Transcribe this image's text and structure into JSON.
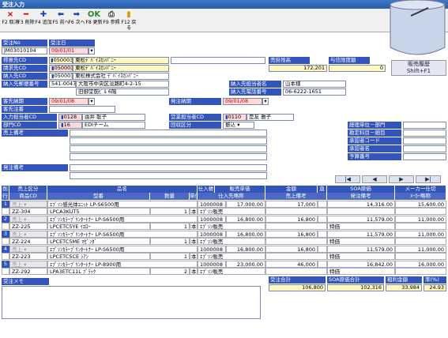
{
  "window": {
    "title": "受注入力"
  },
  "toolbar": [
    {
      "key": "F2",
      "label": "取消",
      "icon": "x-icon",
      "glyph": "×",
      "color": "#c00000"
    },
    {
      "key": "F3",
      "label": "削除",
      "icon": "minus-icon",
      "glyph": "━",
      "color": "#c00000"
    },
    {
      "key": "F4",
      "label": "追加",
      "icon": "plus-icon",
      "glyph": "✚",
      "color": "#2244aa"
    },
    {
      "key": "F5",
      "label": "前へ",
      "icon": "arrow-left-icon",
      "glyph": "⬅",
      "color": "#2244aa"
    },
    {
      "key": "F6",
      "label": "次へ",
      "icon": "arrow-right-icon",
      "glyph": "➡",
      "color": "#2244aa"
    },
    {
      "key": "F8",
      "label": "更新",
      "icon": "ok-icon",
      "glyph": "OK",
      "color": "#228833"
    },
    {
      "key": "F9",
      "label": "参照",
      "icon": "reference-icon",
      "glyph": "⎙",
      "color": "#444444"
    },
    {
      "key": "F12",
      "label": "戻る",
      "icon": "return-icon",
      "glyph": "▮",
      "color": "#d0a000"
    }
  ],
  "side_buttons": {
    "history": "販売履歴",
    "history_key": "Shift+F1"
  },
  "header": {
    "order_no_label": "受注No",
    "order_no": "JM03010104",
    "order_date_label": "受注日",
    "order_date": "09/01/01",
    "sales_price_label": "売掛残高",
    "sales_price": "172,201",
    "credit_label": "与信限度額",
    "credit": "0",
    "customer_label": "得意先CD",
    "customer_code": "0500039",
    "customer_name": "東松ﾃﾞﾊﾞｲｽｶﾝﾊﾟﾆｰ",
    "bill_label": "請求先CD",
    "bill_code": "0500039",
    "bill_name": "東松ﾃﾞﾊﾞｲｽｶﾝﾊﾟﾆｰ",
    "ship_label": "納入先CD",
    "ship_code": "0500039",
    "ship_name": "東松株式会社 ﾃﾞﾊﾞｲｽｶﾝﾊﾟﾆｰ",
    "zip_label": "納入先郵便番号",
    "zip": "541-0047",
    "address1": "大阪市中央区淡路町4-2-15",
    "address2": "旧御堂筋ﾋﾞﾙ 6階",
    "contact_label": "納入先担当者名",
    "contact": "山本様",
    "phone_label": "納入先電話番号",
    "phone": "06-6222-1651",
    "cust_due_label": "客先納期",
    "cust_due": "09/01/08",
    "ship_due_label": "発注納期",
    "ship_due": "09/01/08",
    "cust_order_label": "客先注番",
    "input_staff_label": "入力担当者CD",
    "input_staff_code": "0128",
    "input_staff_name": "由井 聡子",
    "sales_staff_label": "営業担当者CD",
    "sales_staff_code": "0110",
    "sales_staff_name": "是友 雅子",
    "dept_label": "部門CD",
    "dept_code": "16",
    "dept_name": "EDIチーム",
    "collect_label": "回収区分",
    "collect": "振込",
    "remarks_label": "売上備考",
    "order_remarks_label": "発注備考",
    "right_labels": [
      "経理単位－部門",
      "勘定科目－細目",
      "承認者コード",
      "承認者名",
      "予算番号"
    ]
  },
  "grid": {
    "headers": [
      "削",
      "売上区分",
      "品名",
      "仕入帳",
      "販売単価",
      "金額",
      "直",
      "SOA原価",
      "メーカー仕切"
    ],
    "subheaders": [
      "行",
      "商品CD",
      "型番",
      "数量",
      "単位",
      "仕入先略称",
      "売上備考",
      "発注備考",
      "ﾒｰｶｰ略称"
    ],
    "rows": [
      {
        "n": "1",
        "kbn": "売上",
        "name": "ｴﾌﾟｿﾝ感光体ﾕﾆｯﾄ LP-S6500用",
        "code": "ZZ-304",
        "model": "LPCA3KUT5",
        "qty": "1",
        "unit": "本",
        "sup": "1000008",
        "supname": "ｴﾌﾟｿﾝ販売",
        "price": "17,000.00",
        "amount": "17,000",
        "soa": "14,316.00",
        "maker": "15,600.00",
        "note": ""
      },
      {
        "n": "2",
        "kbn": "売上",
        "name": "ｴﾌﾟｿﾝｶﾗｰﾌﾟﾘﾝﾀｰﾄﾅｰ LP-S6500用",
        "code": "ZZ-225",
        "model": "LPCETC5YE",
        "qty": "1",
        "unit": "本",
        "sup": "1000008",
        "supname": "ｴﾌﾟｿﾝ販売",
        "price": "16,800.00",
        "amount": "16,800",
        "soa": "11,579.00",
        "maker": "11,000.00",
        "note": "特価",
        "colorname": "ｲｴﾛｰ"
      },
      {
        "n": "3",
        "kbn": "売上",
        "name": "ｴﾌﾟｿﾝｶﾗｰﾌﾟﾘﾝﾀｰﾄﾅｰ LP-S6500用",
        "code": "ZZ-224",
        "model": "LPCETC5ME",
        "qty": "1",
        "unit": "本",
        "sup": "1000008",
        "supname": "ｴﾌﾟｿﾝ販売",
        "price": "16,800.00",
        "amount": "16,800",
        "soa": "11,579.00",
        "maker": "11,000.00",
        "note": "特価",
        "colorname": "ﾏｾﾞﾝﾀﾞ"
      },
      {
        "n": "4",
        "kbn": "売上",
        "name": "ｴﾌﾟｿﾝｶﾗｰﾌﾟﾘﾝﾀｰﾄﾅｰ LP-S6500用",
        "code": "ZZ-223",
        "model": "LPCETC5CE",
        "qty": "1",
        "unit": "本",
        "sup": "1000008",
        "supname": "ｴﾌﾟｿﾝ販売",
        "price": "16,800.00",
        "amount": "16,800",
        "soa": "11,579.00",
        "maker": "11,000.00",
        "note": "特価",
        "colorname": "ｼｱﾝ"
      },
      {
        "n": "5",
        "kbn": "売上",
        "name": "ｴﾌﾟｿﾝｶﾗｰﾌﾟﾘﾝﾀｰﾄﾅｰ LP-8900用",
        "code": "ZZ-292",
        "model": "LPA3ETC11L",
        "qty": "2",
        "unit": "本",
        "sup": "1000008",
        "supname": "ｴﾌﾟｿﾝ販売",
        "price": "23,000.00",
        "amount": "46,000",
        "soa": "16,842.00",
        "maker": "16,000.00",
        "note": "特価",
        "colorname": "ﾌﾞﾗｯｸ"
      }
    ]
  },
  "footer": {
    "memo_label": "受注メモ",
    "total_label": "受注合計",
    "total": "106,800",
    "soa_total_label": "SOA原価合計",
    "soa_total": "102,316",
    "profit_label": "粗利金額",
    "profit": "33,984",
    "rate_label": "率(%)",
    "rate": "24.93"
  },
  "colors": {
    "label_bg": "#3355bb",
    "yellow": "#fff8c0",
    "pink": "#ffd8d8"
  }
}
